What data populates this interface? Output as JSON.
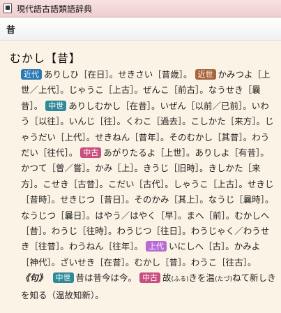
{
  "window": {
    "title": "現代語古語類語辞典"
  },
  "header": {
    "word": "昔"
  },
  "entry": {
    "heading": "むかし【昔】",
    "segments": [
      {
        "tag": "近代",
        "tag_class": "tag-modern",
        "text": "ありしひ［在日］。せきさい［昔歳］。"
      },
      {
        "tag": "近世",
        "tag_class": "tag-early-modern",
        "text": "かみつよ［上世／上代］。じゃうこ［上古］。ぜんこ［前古］。なうせき［曩昔］。"
      },
      {
        "tag": "中世",
        "tag_class": "tag-medieval",
        "text": "ありしむかし［在昔］。いぜん［以前／已前］。いわう［以往］。いんじ［往］。くわこ［過去］。こしかた［来方］。じゃうだい［上代］。せきねん［昔年］。そのむかし［其昔］。わうだい［往代］。"
      },
      {
        "tag": "中古",
        "tag_class": "tag-ancient-mid",
        "text": "あがりたるよ［上世］。ありしよ［有昔］。かつて［曽／嘗］。かみ［上］。きうじ［旧時］。きしかた［来方］。こせき［古昔］。こだい［古代］。しゃうこ［上古］。せきじ［昔時］。せきじつ［昔日］。そのかみ［其上］。なうじ［曩時］。なうじつ［曩日］。はやう／はやく［早］。まへ［前］。むかしへ［昔］。わうじ［往時］。わうじつ［往日］。わうじゃく／わうせき［往昔］。わうねん［往年］。"
      },
      {
        "tag": "上代",
        "tag_class": "tag-ancient",
        "text": "いにしへ［古］。かみよ［神代］。ざいせき［在昔］。むかし［昔］。わうこ［往古］。"
      }
    ],
    "phrase": {
      "label": "《句》",
      "tag1": "中世",
      "text1": "昔は昔今は今。",
      "tag2": "中古",
      "text2a": "故",
      "furi1": "(ふる)",
      "text2b": "きを温",
      "furi2": "(たづ)",
      "text2c": "ねて新しきを知る（温故知新）。"
    }
  }
}
